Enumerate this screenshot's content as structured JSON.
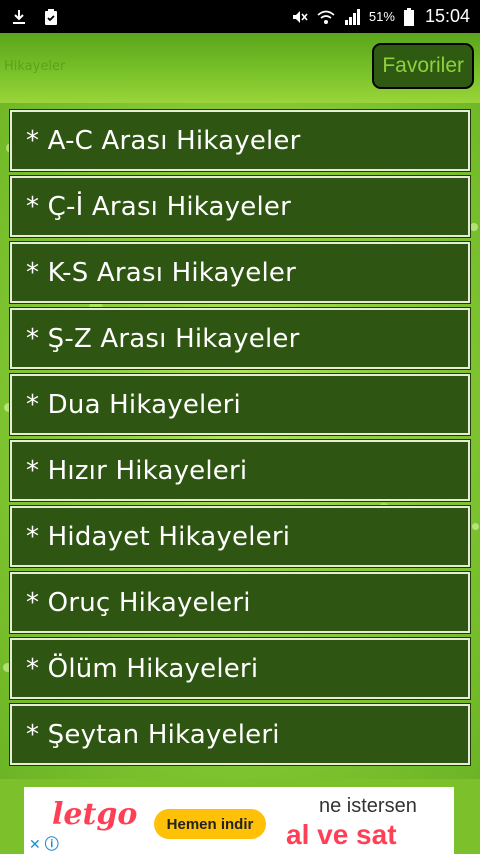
{
  "status_bar": {
    "battery_percent": "51%",
    "time": "15:04",
    "icons": [
      "download-icon",
      "clipboard-icon",
      "mute-icon",
      "wifi-icon",
      "signal-icon",
      "battery-icon"
    ]
  },
  "toolbar": {
    "title": "Hikayeler",
    "favorites_label": "Favoriler"
  },
  "menu": {
    "items": [
      {
        "label": "* A-C Arası Hikayeler"
      },
      {
        "label": "* Ç-İ Arası Hikayeler"
      },
      {
        "label": "* K-S Arası Hikayeler"
      },
      {
        "label": "* Ş-Z Arası Hikayeler"
      },
      {
        "label": "* Dua Hikayeleri"
      },
      {
        "label": "* Hızır Hikayeleri"
      },
      {
        "label": "* Hidayet Hikayeleri"
      },
      {
        "label": "* Oruç Hikayeleri"
      },
      {
        "label": "* Ölüm Hikayeleri"
      },
      {
        "label": "* Şeytan Hikayeleri"
      }
    ]
  },
  "ad": {
    "logo": "letgo",
    "button": "Hemen indir",
    "subline": "ne istersen",
    "headline": "al ve sat"
  },
  "colors": {
    "item_bg": "#2f5512",
    "item_border": "#e6ecd8",
    "background_green": "#8fd03a",
    "ad_accent": "#ff3f55",
    "ad_button": "#ffc107"
  }
}
